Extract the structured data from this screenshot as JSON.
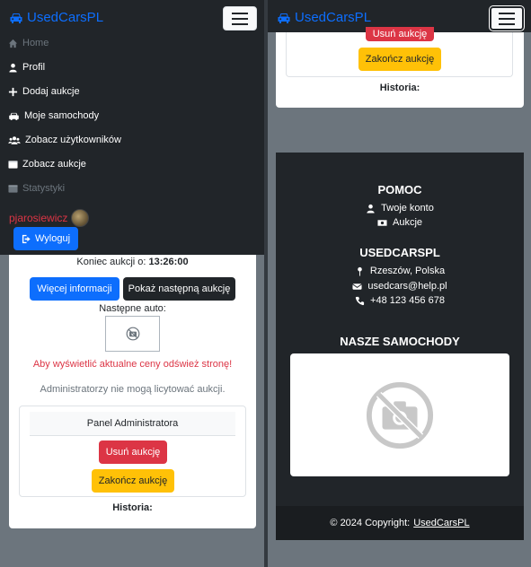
{
  "brand": {
    "name": "UsedCarsPL",
    "color": "#0d6efd",
    "icon": "car-icon"
  },
  "nav": {
    "items": [
      {
        "label": "Home",
        "icon": "home-icon",
        "muted": true
      },
      {
        "label": "Profil",
        "icon": "user-icon"
      },
      {
        "label": "Dodaj aukcje",
        "icon": "plus-icon"
      },
      {
        "label": "Moje samochody",
        "icon": "car-icon"
      },
      {
        "label": "Zobacz użytkowników",
        "icon": "users-icon"
      },
      {
        "label": "Zobacz aukcje",
        "icon": "window-icon"
      },
      {
        "label": "Statystyki",
        "icon": "chart-icon",
        "muted": true
      }
    ],
    "username": "pjarosiewicz",
    "logout_label": "Wyloguj"
  },
  "auction": {
    "end_label": "Koniec aukcji o:",
    "end_time": "13:26:00",
    "more_info_label": "Więcej informacji",
    "next_auction_label": "Pokaż następną aukcję",
    "next_car_label": "Następne auto:",
    "refresh_warning": "Aby wyświetlić aktualne ceny odśwież stronę!",
    "admin_notice": "Administratorzy nie mogą licytować aukcji.",
    "admin_panel_title": "Panel Administratora",
    "delete_label": "Usuń aukcję",
    "finish_label": "Zakończ aukcję",
    "history_label": "Historia:"
  },
  "footer": {
    "help": {
      "title": "POMOC",
      "links": [
        "Twoje konto",
        "Aukcje"
      ]
    },
    "company": {
      "title": "USEDCARSPL",
      "address": "Rzeszów, Polska",
      "email": "usedcars@help.pl",
      "phone": "+48 123 456 678"
    },
    "cars_title": "NASZE SAMOCHODY",
    "copyright_prefix": "© 2024 Copyright:",
    "copyright_link": "UsedCarsPL"
  }
}
